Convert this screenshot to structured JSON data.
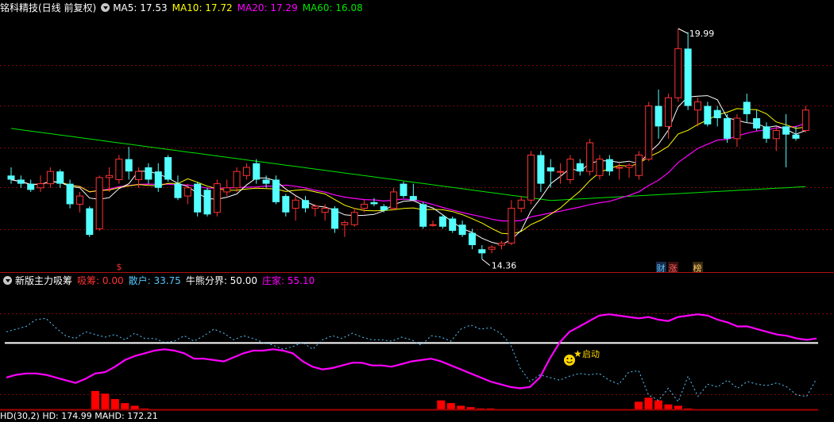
{
  "colors": {
    "background": "#000000",
    "grid": "#7a0a0a",
    "up": "#ff3232",
    "down": "#54ffff",
    "ma5": "#ffffff",
    "ma10": "#ffff00",
    "ma20": "#ff00ff",
    "ma60": "#00e600",
    "scatter": "#54c8ff",
    "mainforce": "#ff00ff",
    "absorb": "#ff0000",
    "threshold": "#ffffff"
  },
  "top": {
    "stock_name": "铭科精技(日线 前复权)",
    "ma5": "MA5: 17.53",
    "ma10": "MA10: 17.72",
    "ma20": "MA20: 17.29",
    "ma60": "MA60: 16.08",
    "high_label": "19.99",
    "low_label": "14.36",
    "markers": {
      "dollar": "$",
      "cai": "财",
      "zhang": "涨",
      "bang": "榜"
    }
  },
  "indicator": {
    "name": "新版主力吸筹",
    "absorb": "吸筹: 0.00",
    "retail": "散户: 33.75",
    "divide": "牛熊分界: 50.00",
    "mainforce": "庄家: 55.10",
    "signal": "启动"
  },
  "bottom": {
    "label": "HD(30,2) HD: 174.99 MAHD: 172.21"
  },
  "chart_data": [
    {
      "type": "candlestick",
      "title": "铭科精技(日线 前复权)",
      "ohlc": [
        [
          16.4,
          16.6,
          16.2,
          16.3
        ],
        [
          16.3,
          16.4,
          16.1,
          16.2
        ],
        [
          16.2,
          16.3,
          16.0,
          16.05
        ],
        [
          16.1,
          16.4,
          16.0,
          16.2
        ],
        [
          16.2,
          16.6,
          16.1,
          16.5
        ],
        [
          16.5,
          16.55,
          16.1,
          16.2
        ],
        [
          16.2,
          16.3,
          15.6,
          15.7
        ],
        [
          15.7,
          16.0,
          15.5,
          15.9
        ],
        [
          15.6,
          15.65,
          14.9,
          14.95
        ],
        [
          15.1,
          16.4,
          15.05,
          16.35
        ],
        [
          16.35,
          16.6,
          16.0,
          16.4
        ],
        [
          16.3,
          16.9,
          16.2,
          16.8
        ],
        [
          16.8,
          17.1,
          16.3,
          16.5
        ],
        [
          16.3,
          16.6,
          16.1,
          16.5
        ],
        [
          16.6,
          16.7,
          16.2,
          16.3
        ],
        [
          16.5,
          16.7,
          16.0,
          16.1
        ],
        [
          16.85,
          16.9,
          16.25,
          16.3
        ],
        [
          16.2,
          16.4,
          15.8,
          15.85
        ],
        [
          15.9,
          16.2,
          15.7,
          16.1
        ],
        [
          16.2,
          16.25,
          15.4,
          15.5
        ],
        [
          16.05,
          16.1,
          15.4,
          15.45
        ],
        [
          15.5,
          16.3,
          15.4,
          16.2
        ],
        [
          16.0,
          16.3,
          15.9,
          16.1
        ],
        [
          16.1,
          16.6,
          16.0,
          16.5
        ],
        [
          16.4,
          16.7,
          16.3,
          16.6
        ],
        [
          16.7,
          16.8,
          16.2,
          16.3
        ],
        [
          16.3,
          16.4,
          16.1,
          16.2
        ],
        [
          16.3,
          16.4,
          15.7,
          15.75
        ],
        [
          15.9,
          15.95,
          15.4,
          15.5
        ],
        [
          15.6,
          15.9,
          15.3,
          15.8
        ],
        [
          15.8,
          15.9,
          15.5,
          15.6
        ],
        [
          15.6,
          15.7,
          15.4,
          15.65
        ],
        [
          15.5,
          15.7,
          15.3,
          15.6
        ],
        [
          15.6,
          15.65,
          15.0,
          15.1
        ],
        [
          15.2,
          15.3,
          14.9,
          15.25
        ],
        [
          15.2,
          15.6,
          15.15,
          15.5
        ],
        [
          15.6,
          15.8,
          15.5,
          15.7
        ],
        [
          15.75,
          15.85,
          15.65,
          15.7
        ],
        [
          15.65,
          15.7,
          15.5,
          15.55
        ],
        [
          15.6,
          16.1,
          15.55,
          16.0
        ],
        [
          16.2,
          16.25,
          15.85,
          15.9
        ],
        [
          15.9,
          16.2,
          15.8,
          15.8
        ],
        [
          15.7,
          15.75,
          15.1,
          15.15
        ],
        [
          15.2,
          15.3,
          15.15,
          15.2
        ],
        [
          15.4,
          15.45,
          15.1,
          15.15
        ],
        [
          15.35,
          15.4,
          15.0,
          15.05
        ],
        [
          15.2,
          15.3,
          14.9,
          14.95
        ],
        [
          15.0,
          15.1,
          14.6,
          14.7
        ],
        [
          14.6,
          14.7,
          14.36,
          14.5
        ],
        [
          14.6,
          14.7,
          14.5,
          14.65
        ],
        [
          14.7,
          14.8,
          14.6,
          14.75
        ],
        [
          14.75,
          15.8,
          14.7,
          15.6
        ],
        [
          15.6,
          15.9,
          15.5,
          15.8
        ],
        [
          15.8,
          17.0,
          15.7,
          16.9
        ],
        [
          16.9,
          17.0,
          16.0,
          16.2
        ],
        [
          16.6,
          16.8,
          16.1,
          16.5
        ],
        [
          16.5,
          16.7,
          16.2,
          16.5
        ],
        [
          16.3,
          16.9,
          16.2,
          16.8
        ],
        [
          16.7,
          16.8,
          16.4,
          16.5
        ],
        [
          16.5,
          17.3,
          16.4,
          17.2
        ],
        [
          16.4,
          16.9,
          16.3,
          16.8
        ],
        [
          16.8,
          16.9,
          16.4,
          16.5
        ],
        [
          16.6,
          16.7,
          16.3,
          16.6
        ],
        [
          16.6,
          16.7,
          16.35,
          16.65
        ],
        [
          16.4,
          17.0,
          16.3,
          16.9
        ],
        [
          16.8,
          18.2,
          16.75,
          18.1
        ],
        [
          18.1,
          18.5,
          17.3,
          17.6
        ],
        [
          17.6,
          18.4,
          17.3,
          18.3
        ],
        [
          18.3,
          19.99,
          18.2,
          19.5
        ],
        [
          19.5,
          19.9,
          18.0,
          18.1
        ],
        [
          18.0,
          18.3,
          17.6,
          18.2
        ],
        [
          18.1,
          18.2,
          17.6,
          17.65
        ],
        [
          18.0,
          18.1,
          17.6,
          17.8
        ],
        [
          17.8,
          17.9,
          17.2,
          17.3
        ],
        [
          17.3,
          17.9,
          17.1,
          17.8
        ],
        [
          18.2,
          18.4,
          17.7,
          17.9
        ],
        [
          17.8,
          18.0,
          17.5,
          17.55
        ],
        [
          17.6,
          17.7,
          17.2,
          17.3
        ],
        [
          17.3,
          17.6,
          17.0,
          17.5
        ],
        [
          17.6,
          17.9,
          16.6,
          17.4
        ],
        [
          17.4,
          17.6,
          17.25,
          17.3
        ],
        [
          17.5,
          18.1,
          17.45,
          18.0
        ]
      ],
      "ylim": [
        14.1,
        20.3
      ],
      "legend": [
        "MA5: 17.53",
        "MA10: 17.72",
        "MA20: 17.29",
        "MA60: 16.08"
      ]
    },
    {
      "type": "line",
      "title": "新版主力吸筹",
      "series": [
        {
          "name": "散户",
          "values": [
            58,
            60,
            62,
            67,
            68,
            61,
            55,
            53,
            58,
            56,
            54,
            56,
            52,
            57,
            53,
            53,
            50,
            51,
            55,
            51,
            55,
            60,
            57,
            52,
            55,
            53,
            50,
            48,
            45,
            47,
            50,
            45,
            52,
            55,
            53,
            57,
            54,
            52,
            52,
            51,
            54,
            52,
            48,
            55,
            54,
            51,
            60,
            63,
            60,
            61,
            57,
            49,
            31,
            21,
            26,
            24,
            22,
            25,
            27,
            26,
            27,
            22,
            19,
            28,
            29,
            11,
            7,
            16,
            6,
            25,
            10,
            19,
            17,
            22,
            16,
            21,
            19,
            18,
            20,
            17,
            11,
            10,
            23
          ]
        },
        {
          "name": "庄家",
          "values": [
            24,
            26,
            27,
            27,
            26,
            24,
            22,
            20,
            23,
            27,
            28,
            32,
            37,
            40,
            42,
            44,
            45,
            44,
            42,
            38,
            38,
            37,
            36,
            39,
            42,
            44,
            44,
            45,
            44,
            42,
            36,
            32,
            30,
            31,
            33,
            35,
            35,
            33,
            33,
            32,
            34,
            36,
            37,
            38,
            36,
            33,
            30,
            27,
            24,
            21,
            19,
            17,
            16,
            17,
            24,
            38,
            50,
            58,
            62,
            66,
            70,
            71,
            70,
            69,
            68,
            69,
            67,
            66,
            69,
            70,
            71,
            70,
            67,
            65,
            62,
            62,
            60,
            58,
            56,
            55,
            53,
            52,
            53
          ]
        },
        {
          "name": "吸筹",
          "values": [
            0,
            0,
            0,
            0,
            0,
            0,
            0,
            0,
            0,
            14,
            12,
            8,
            5,
            3,
            1,
            0,
            0,
            0,
            0,
            0,
            0,
            0,
            0,
            0,
            0,
            0,
            0,
            0,
            0,
            0,
            0,
            0,
            0,
            0,
            0,
            0,
            0,
            0,
            0,
            0,
            0,
            0,
            0,
            0,
            7,
            5,
            3,
            2,
            1,
            1,
            0,
            0,
            0,
            0,
            0,
            0,
            0,
            0,
            0,
            0,
            0,
            0,
            0,
            0,
            6,
            9,
            7,
            4,
            3,
            1,
            0,
            0,
            0,
            0,
            0,
            0,
            0,
            0,
            0,
            0,
            0,
            0,
            0
          ]
        }
      ],
      "threshold": 50,
      "ylim": [
        -2,
        90
      ]
    }
  ]
}
